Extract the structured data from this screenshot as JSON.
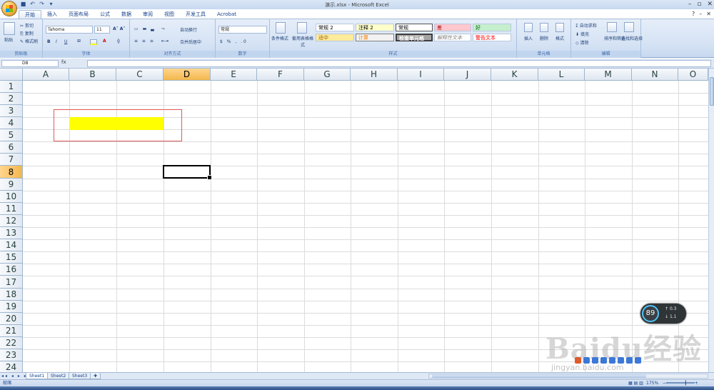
{
  "window": {
    "title": "演示.xlsx - Microsoft Excel"
  },
  "tabs": [
    "开始",
    "插入",
    "页面布局",
    "公式",
    "数据",
    "审阅",
    "视图",
    "开发工具",
    "Acrobat"
  ],
  "ribbon": {
    "clipboard": {
      "label": "剪贴板",
      "paste": "粘贴",
      "cut": "剪切",
      "copy": "复制",
      "format_painter": "格式刷"
    },
    "font": {
      "label": "字体",
      "name": "Tahoma",
      "size": "11"
    },
    "alignment": {
      "label": "对齐方式",
      "wrap": "自动换行",
      "merge": "合并后居中"
    },
    "number": {
      "label": "数字",
      "format": "常规"
    },
    "styles": {
      "label": "样式",
      "conditional": "条件格式",
      "as_table": "套用表格格式",
      "cells": [
        "常规 2",
        "注释 2",
        "常规",
        "差",
        "好",
        "适中",
        "计算",
        "检查单元格",
        "解释性文本",
        "警告文本"
      ]
    },
    "cells": {
      "label": "单元格",
      "insert": "插入",
      "delete": "删除",
      "format": "格式"
    },
    "editing": {
      "label": "编辑",
      "autosum": "自动求和",
      "fill": "填充",
      "clear": "清除",
      "sort": "排序和筛选",
      "find": "查找和选择"
    }
  },
  "formula_bar": {
    "name_box": "D8",
    "fx": "fx",
    "formula": ""
  },
  "grid": {
    "columns": [
      "A",
      "B",
      "C",
      "D",
      "E",
      "F",
      "G",
      "H",
      "I",
      "J",
      "K",
      "L",
      "M",
      "N",
      "O"
    ],
    "rows": [
      "1",
      "2",
      "3",
      "4",
      "5",
      "6",
      "7",
      "8",
      "9",
      "10",
      "11",
      "12",
      "13",
      "14",
      "15",
      "16",
      "17",
      "18",
      "19",
      "20",
      "21",
      "22",
      "23",
      "24"
    ],
    "selected_column": "D",
    "selected_row": "8",
    "fill_color": "#ffff00",
    "highlight_border_color": "#e05a5a"
  },
  "sheets": [
    "Sheet1",
    "Sheet2",
    "Sheet3"
  ],
  "status": {
    "mode": "就绪",
    "zoom": "175%"
  },
  "overlay": {
    "speed_percent": "89",
    "up": "0.3",
    "down": "1.1",
    "watermark": "Baidu经验",
    "watermark_sub": "jingyan.baidu.com"
  }
}
